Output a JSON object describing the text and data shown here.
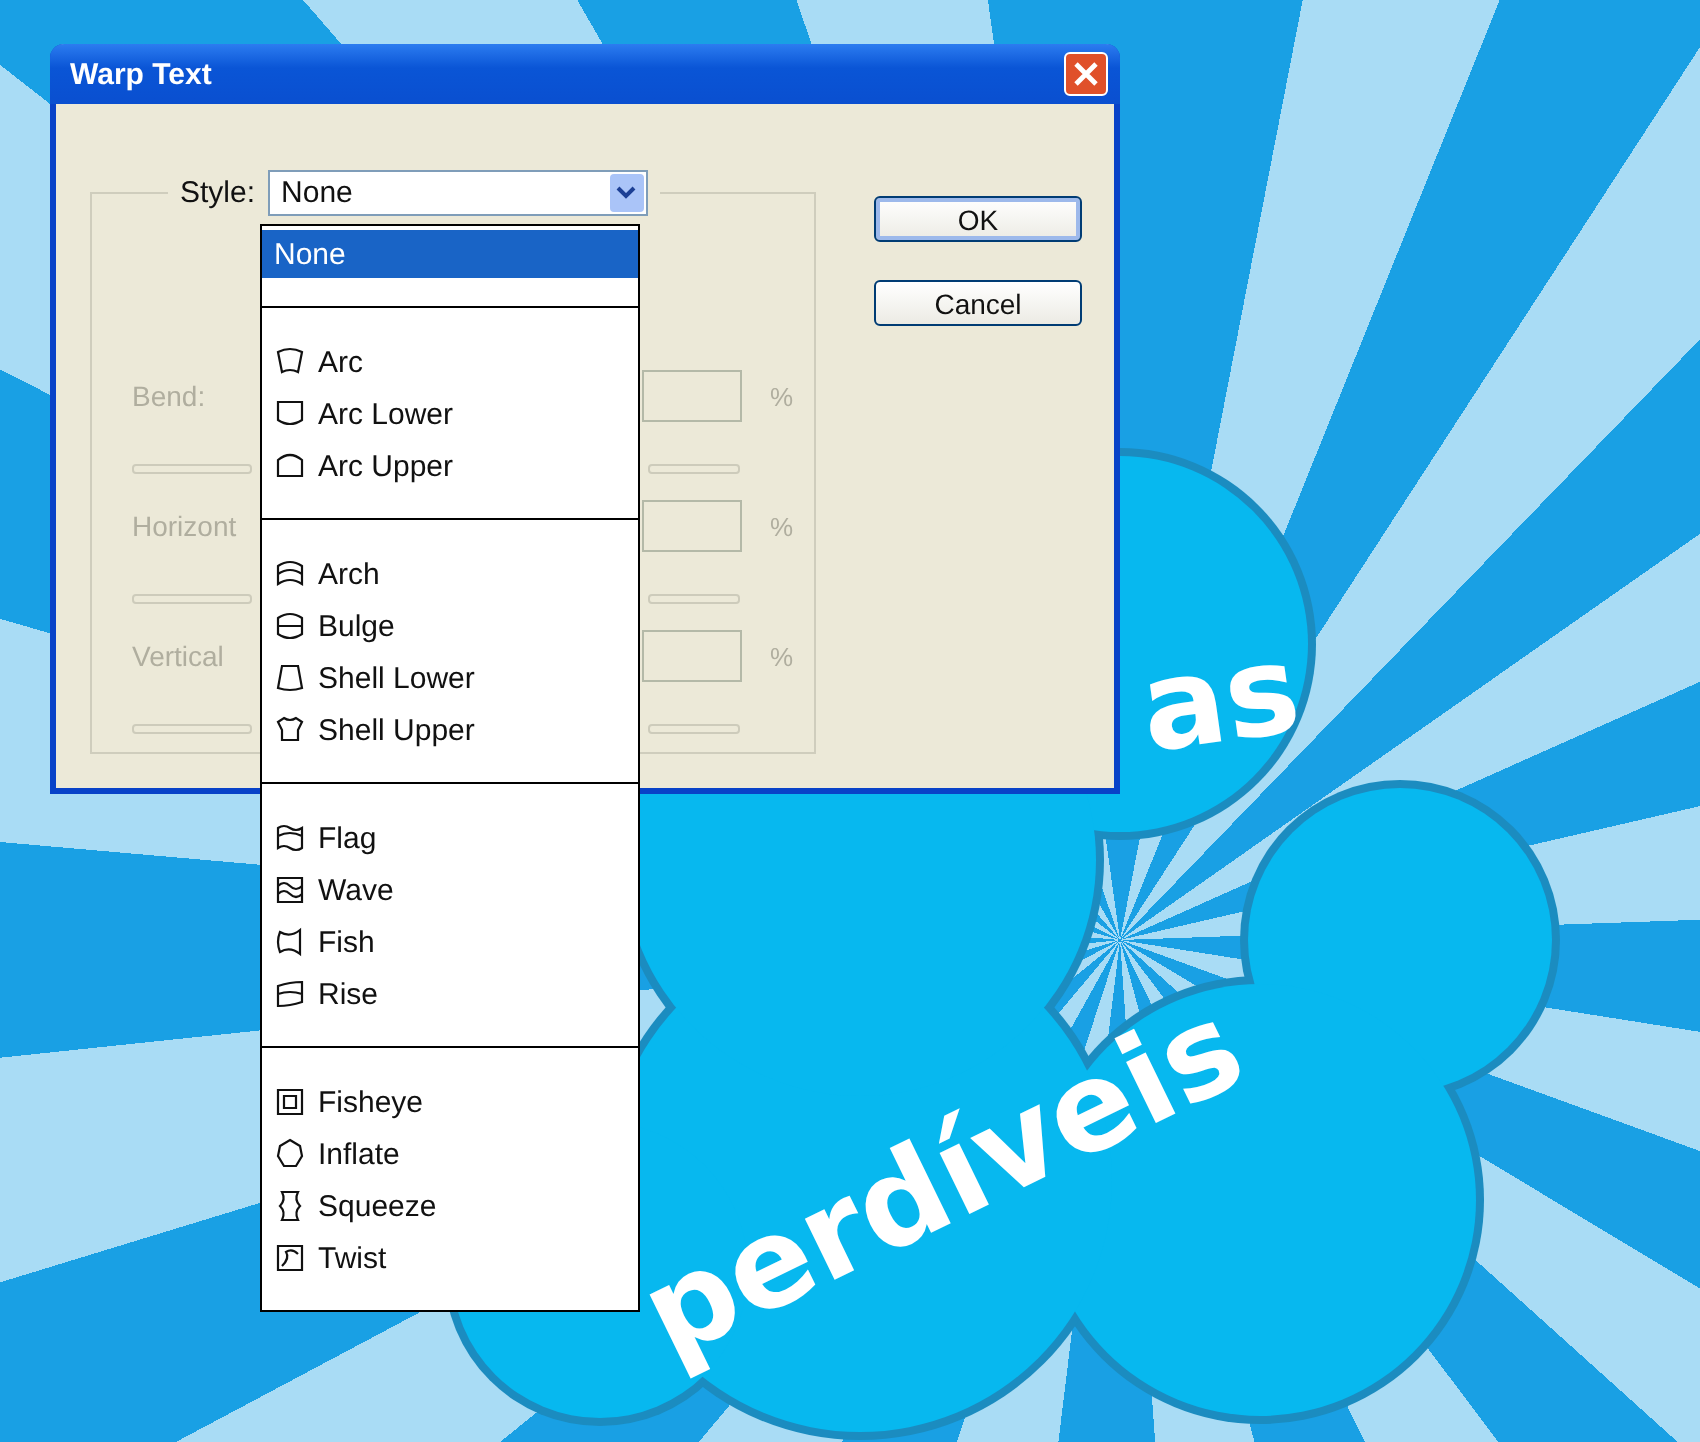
{
  "window": {
    "title": "Warp Text"
  },
  "style": {
    "label": "Style:",
    "value": "None",
    "expanded": true
  },
  "style_options": [
    {
      "items": [
        {
          "label": "None",
          "selected": true
        }
      ]
    },
    {
      "items": [
        {
          "label": "Arc",
          "selected": false
        },
        {
          "label": "Arc Lower",
          "selected": false
        },
        {
          "label": "Arc Upper",
          "selected": false
        }
      ]
    },
    {
      "items": [
        {
          "label": "Arch",
          "selected": false
        },
        {
          "label": "Bulge",
          "selected": false
        },
        {
          "label": "Shell Lower",
          "selected": false
        },
        {
          "label": "Shell Upper",
          "selected": false
        }
      ]
    },
    {
      "items": [
        {
          "label": "Flag",
          "selected": false
        },
        {
          "label": "Wave",
          "selected": false
        },
        {
          "label": "Fish",
          "selected": false
        },
        {
          "label": "Rise",
          "selected": false
        }
      ]
    },
    {
      "items": [
        {
          "label": "Fisheye",
          "selected": false
        },
        {
          "label": "Inflate",
          "selected": false
        },
        {
          "label": "Squeeze",
          "selected": false
        },
        {
          "label": "Twist",
          "selected": false
        }
      ]
    }
  ],
  "settings": [
    {
      "label": "Bend:",
      "unit": "%",
      "disabled": true
    },
    {
      "label": "Horizont",
      "unit": "%",
      "disabled": true
    },
    {
      "label": "Vertical",
      "unit": "%",
      "disabled": true
    }
  ],
  "buttons": [
    {
      "label": "OK",
      "default": true
    },
    {
      "label": "Cancel",
      "default": false
    }
  ],
  "canvas": {
    "texts": [
      "as",
      "perdíveis"
    ]
  }
}
